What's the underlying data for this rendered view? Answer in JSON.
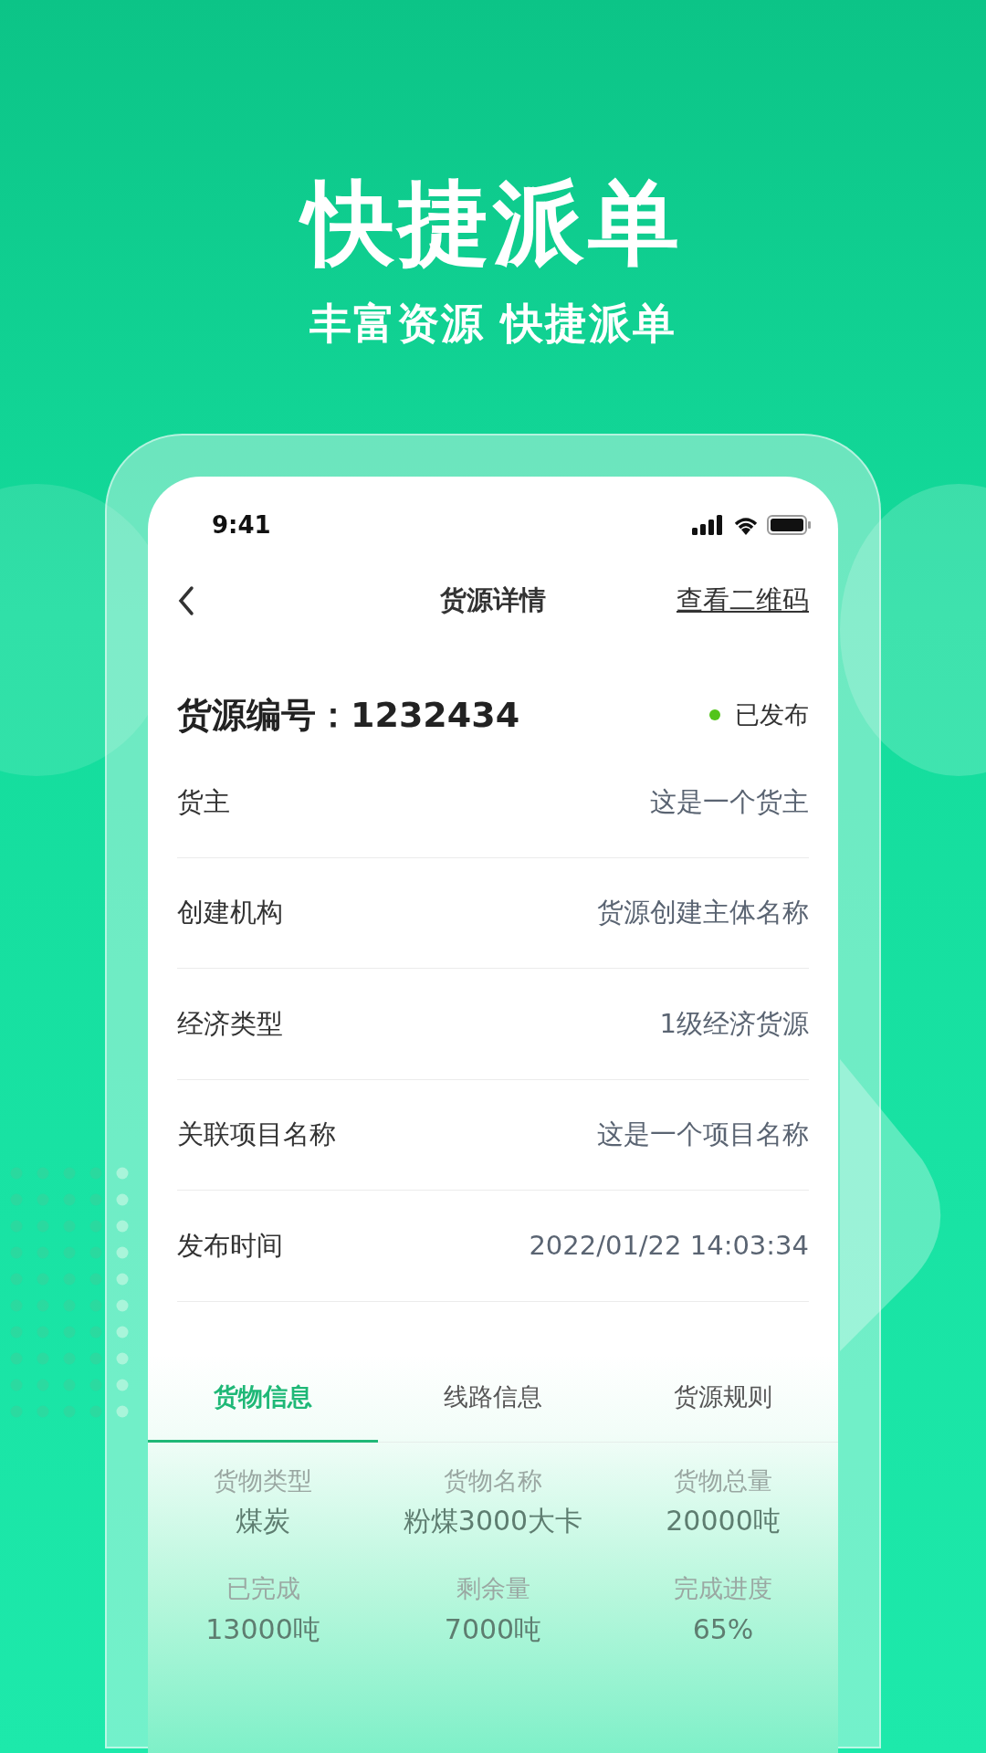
{
  "headline": "快捷派单",
  "subtitle": "丰富资源 快捷派单",
  "status_bar": {
    "time": "9:41"
  },
  "nav": {
    "title": "货源详情",
    "action": "查看二维码"
  },
  "cargo": {
    "number": "货源编号：1232434",
    "status": "已发布"
  },
  "details": [
    {
      "label": "货主",
      "value": "这是一个货主"
    },
    {
      "label": "创建机构",
      "value": "货源创建主体名称"
    },
    {
      "label": "经济类型",
      "value": "1级经济货源"
    },
    {
      "label": "关联项目名称",
      "value": "这是一个项目名称"
    },
    {
      "label": "发布时间",
      "value": "2022/01/22 14:03:34"
    }
  ],
  "tabs": [
    {
      "label": "货物信息",
      "selected": true
    },
    {
      "label": "线路信息",
      "selected": false
    },
    {
      "label": "货源规则",
      "selected": false
    }
  ],
  "cargo_info": [
    {
      "label": "货物类型",
      "value": "煤炭"
    },
    {
      "label": "货物名称",
      "value": "粉煤3000大卡"
    },
    {
      "label": "货物总量",
      "value": "20000吨"
    },
    {
      "label": "已完成",
      "value": "13000吨"
    },
    {
      "label": "剩余量",
      "value": "7000吨"
    },
    {
      "label": "完成进度",
      "value": "65%"
    }
  ]
}
